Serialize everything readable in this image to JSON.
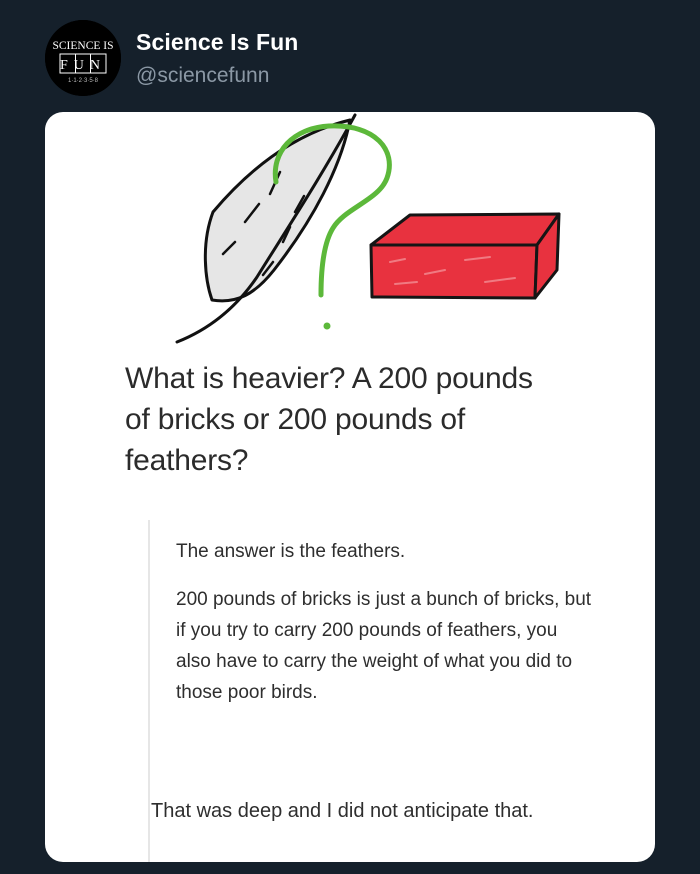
{
  "tweet": {
    "display_name": "Science Is Fun",
    "handle": "@sciencefunn",
    "avatar": {
      "line1": "SCIENCE IS",
      "line2": "FUN",
      "line3": "1·1·2·3·5·8"
    }
  },
  "image": {
    "question": "What is heavier? A 200 pounds of bricks or 200 pounds of feathers?",
    "answer_intro": "The answer is the feathers.",
    "answer_body": "200 pounds of bricks is just a bunch of bricks, but if you try to carry 200 pounds of feathers, you also have to carry the weight of what you did to those poor birds.",
    "response": "That was deep and I did not anticipate that."
  },
  "colors": {
    "background": "#15202b",
    "card": "#ffffff",
    "brick": "#e8323f",
    "question_mark": "#5cb83a",
    "feather": "#e6e6e6"
  },
  "icons": [
    "feather-icon",
    "question-mark-icon",
    "brick-icon"
  ]
}
